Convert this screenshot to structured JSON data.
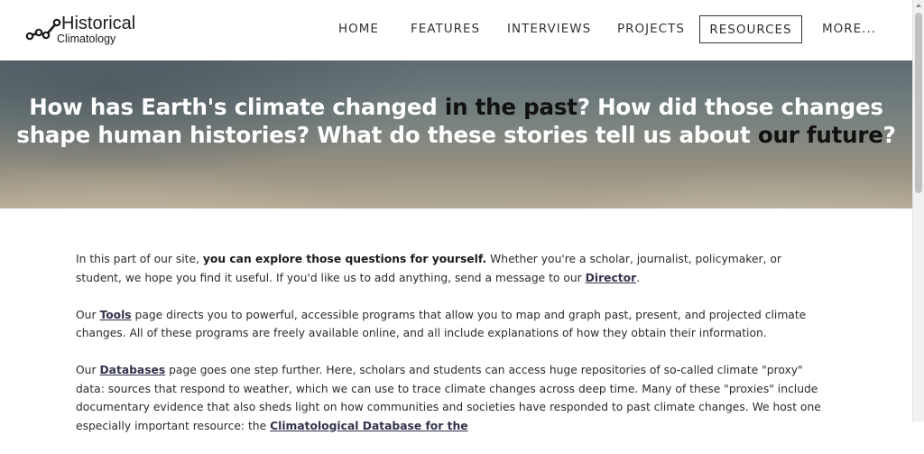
{
  "header": {
    "logo": {
      "title": "Historical",
      "subtitle": "Climatology"
    },
    "nav": {
      "items": [
        {
          "label": "HOME"
        },
        {
          "label": "FEATURES"
        },
        {
          "label": "INTERVIEWS"
        },
        {
          "label": "PROJECTS"
        },
        {
          "label": "RESOURCES",
          "active": true
        },
        {
          "label": "MORE..."
        }
      ]
    }
  },
  "hero": {
    "part1": "How has Earth's climate changed ",
    "part2": "in the past",
    "part3": "? How did those changes",
    "part4": "shape human histories? What do these stories tell us about ",
    "part5": "our future",
    "part6": "?"
  },
  "content": {
    "p1": {
      "a": "In this part of our site, ",
      "b": "you can explore those questions for yourself.",
      "c": " Whether you're a scholar, journalist, policymaker, or student, we hope you find it useful. If you'd like us to add anything, send a message to our ",
      "link": "Director",
      "d": "."
    },
    "p2": {
      "a": "Our ",
      "link": "Tools",
      "b": " page directs you to powerful, accessible programs that allow you to map and graph past, present, and projected climate changes. All of these programs are freely available online, and all include explanations of how they obtain their information."
    },
    "p3": {
      "a": "Our ",
      "link": "Databases",
      "b": " page goes one step further. Here, scholars and students can access huge repositories of so-called climate \"proxy\" data: sources that respond to weather, which we can use to trace climate changes across deep time. Many of these \"proxies\" include documentary evidence that also sheds light on how communities and societies have responded to past climate changes. We host one especially important resource: the ",
      "link2": "Climatological Database for the"
    }
  },
  "colors": {
    "link": "#33334d",
    "hero_text": "#ffffff",
    "hero_highlight": "#111111",
    "nav_text": "#333333"
  }
}
